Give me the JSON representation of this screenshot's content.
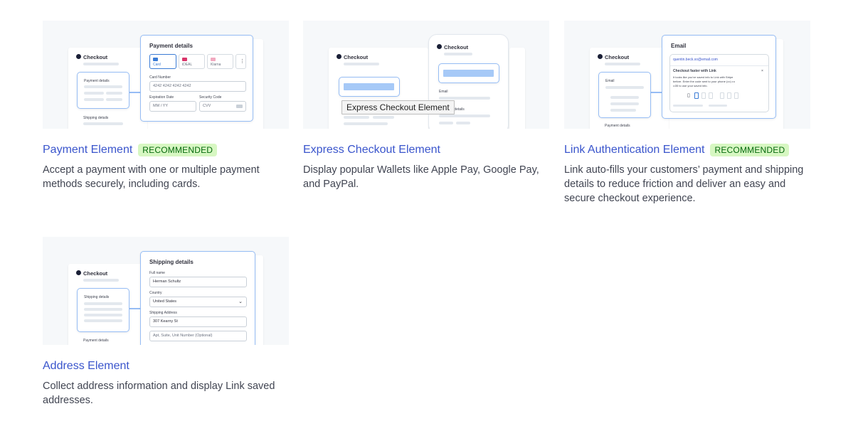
{
  "cards": [
    {
      "title": "Payment Element",
      "badge": "RECOMMENDED",
      "description": "Accept a payment with one or multiple payment methods securely, including cards.",
      "thumbnail": {
        "checkout_label": "Checkout",
        "section_label": "Payment details",
        "shipping_label": "Shipping details",
        "panel_title": "Payment details",
        "tabs": [
          "Card",
          "iDEAL",
          "Klarna"
        ],
        "card_number_label": "Card Number",
        "card_number_value": "4242 4242 4242 4242",
        "expiration_label": "Expiration Date",
        "expiration_placeholder": "MM / YY",
        "security_label": "Security Code",
        "security_placeholder": "CVV"
      }
    },
    {
      "title": "Express Checkout Element",
      "badge": "",
      "description": "Display popular Wallets like Apple Pay, Google Pay, and PayPal.",
      "tooltip": "Express Checkout Element",
      "thumbnail": {
        "checkout_label": "Checkout",
        "phone_checkout_label": "Checkout",
        "email_label": "Email",
        "shipping_partial_label": "ent details"
      }
    },
    {
      "title": "Link Authentication Element",
      "badge": "RECOMMENDED",
      "description": "Link auto-fills your customers’ payment and shipping details to reduce friction and deliver an easy and secure checkout experience.",
      "thumbnail": {
        "checkout_label": "Checkout",
        "section_label": "Email",
        "payment_label": "Payment details",
        "panel_title": "Email",
        "email_value": "quentin.beck.xo@email.com",
        "link_title": "Checkout faster with Link",
        "link_text_1": "It looks like you've saved info to Link with Stripe",
        "link_text_2": "before. Enter the code sent to your phone (•••) •••",
        "link_text_3": "••35 to use your saved info.",
        "close_glyph": "×"
      }
    },
    {
      "title": "Address Element",
      "badge": "",
      "description": "Collect address information and display Link saved addresses.",
      "thumbnail": {
        "checkout_label": "Checkout",
        "section_label": "Shipping details",
        "payment_label": "Payment details",
        "panel_title": "Shipping details",
        "full_name_label": "Full name",
        "full_name_value": "Herman Schultz",
        "country_label": "Country",
        "country_value": "United States",
        "address_label": "Shipping Address",
        "address_value": "307 Kearny St",
        "address2_placeholder": "Apt, Suite, Unit Number (Optional)"
      }
    }
  ]
}
